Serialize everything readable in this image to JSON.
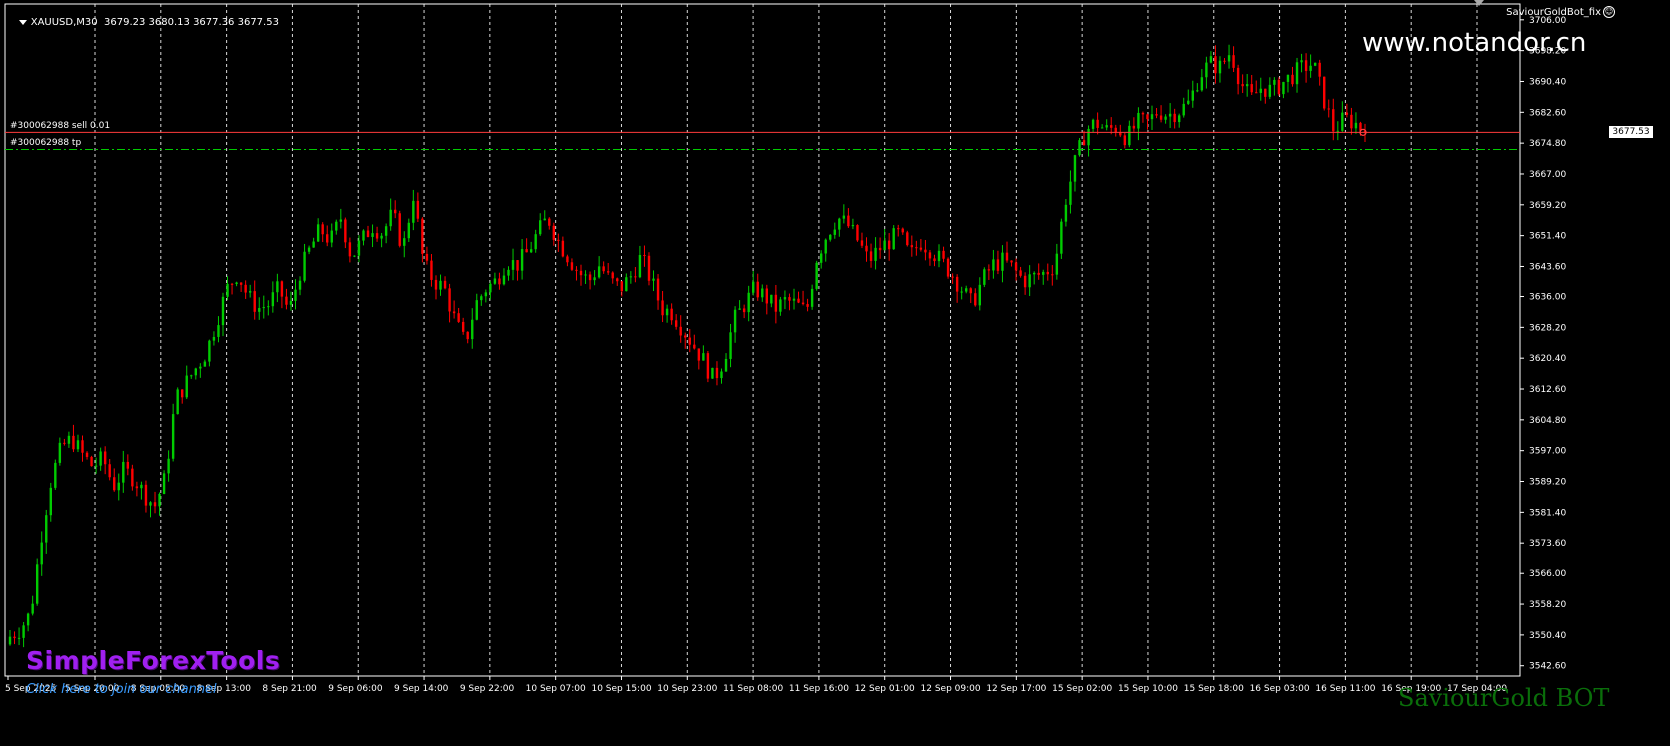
{
  "header": {
    "symbol": "XAUUSD,M30",
    "ohlc": "3679.23 3680.13 3677.36 3677.53"
  },
  "expert": {
    "name": "SaviourGoldBot_fix",
    "icon": "smiley-icon"
  },
  "overlay": {
    "website": "www.notandor.cn",
    "brand": "SimpleForexTools",
    "join_link": "Click here to join our channel",
    "bot_label": "SaviourGold BOT"
  },
  "orders": {
    "sell_label": "#300062988 sell 0.01",
    "tp_label": "#300062988 tp",
    "sell_price": 3677.53,
    "tp_price": 3673.2
  },
  "current_price_label": "3677.53",
  "colors": {
    "background": "#000000",
    "bull_candle": "#00cc00",
    "bear_candle": "#ff0000",
    "grid": "#ffffff",
    "sell_line": "#ff3b3b",
    "tp_line": "#00cc00",
    "axis_text": "#ffffff"
  },
  "chart_data": {
    "type": "candlestick",
    "symbol": "XAUUSD",
    "timeframe": "M30",
    "y_ticks": [
      3706.0,
      3698.2,
      3690.4,
      3682.6,
      3674.8,
      3667.0,
      3659.2,
      3651.4,
      3643.6,
      3636.0,
      3628.2,
      3620.4,
      3612.6,
      3604.8,
      3597.0,
      3589.2,
      3581.4,
      3573.6,
      3566.0,
      3558.2,
      3550.4,
      3542.6
    ],
    "x_ticks": [
      "5 Sep 2025",
      "5 Sep 20:00",
      "8 Sep 05:00",
      "8 Sep 13:00",
      "8 Sep 21:00",
      "9 Sep 06:00",
      "9 Sep 14:00",
      "9 Sep 22:00",
      "10 Sep 07:00",
      "10 Sep 15:00",
      "10 Sep 23:00",
      "11 Sep 08:00",
      "11 Sep 16:00",
      "12 Sep 01:00",
      "12 Sep 09:00",
      "12 Sep 17:00",
      "15 Sep 02:00",
      "15 Sep 10:00",
      "15 Sep 18:00",
      "16 Sep 03:00",
      "16 Sep 11:00",
      "16 Sep 19:00",
      "17 Sep 04:00"
    ],
    "ylim": [
      3542.6,
      3706.0
    ],
    "close_path": [
      3550,
      3552,
      3556,
      3575,
      3590,
      3598,
      3600,
      3596,
      3593,
      3595,
      3588,
      3592,
      3590,
      3586,
      3583,
      3590,
      3610,
      3614,
      3618,
      3622,
      3630,
      3638,
      3642,
      3636,
      3633,
      3634,
      3638,
      3632,
      3642,
      3648,
      3653,
      3650,
      3656,
      3646,
      3650,
      3654,
      3652,
      3657,
      3648,
      3662,
      3644,
      3640,
      3638,
      3630,
      3624,
      3634,
      3638,
      3640,
      3645,
      3644,
      3647,
      3652,
      3656,
      3650,
      3646,
      3642,
      3640,
      3644,
      3640,
      3638,
      3641,
      3646,
      3640,
      3633,
      3632,
      3628,
      3624,
      3620,
      3615,
      3620,
      3630,
      3634,
      3638,
      3636,
      3633,
      3635,
      3634,
      3632,
      3646,
      3652,
      3656,
      3654,
      3650,
      3645,
      3648,
      3650,
      3652,
      3646,
      3650,
      3648,
      3645,
      3642,
      3638,
      3634,
      3640,
      3644,
      3645,
      3643,
      3640,
      3641,
      3642,
      3644,
      3660,
      3670,
      3678,
      3680,
      3678,
      3679,
      3676,
      3680,
      3680,
      3683,
      3682,
      3683,
      3685,
      3692,
      3695,
      3694,
      3698,
      3690,
      3686,
      3689,
      3688,
      3690,
      3692,
      3694,
      3695,
      3686,
      3678,
      3681,
      3680,
      3677.53
    ]
  }
}
